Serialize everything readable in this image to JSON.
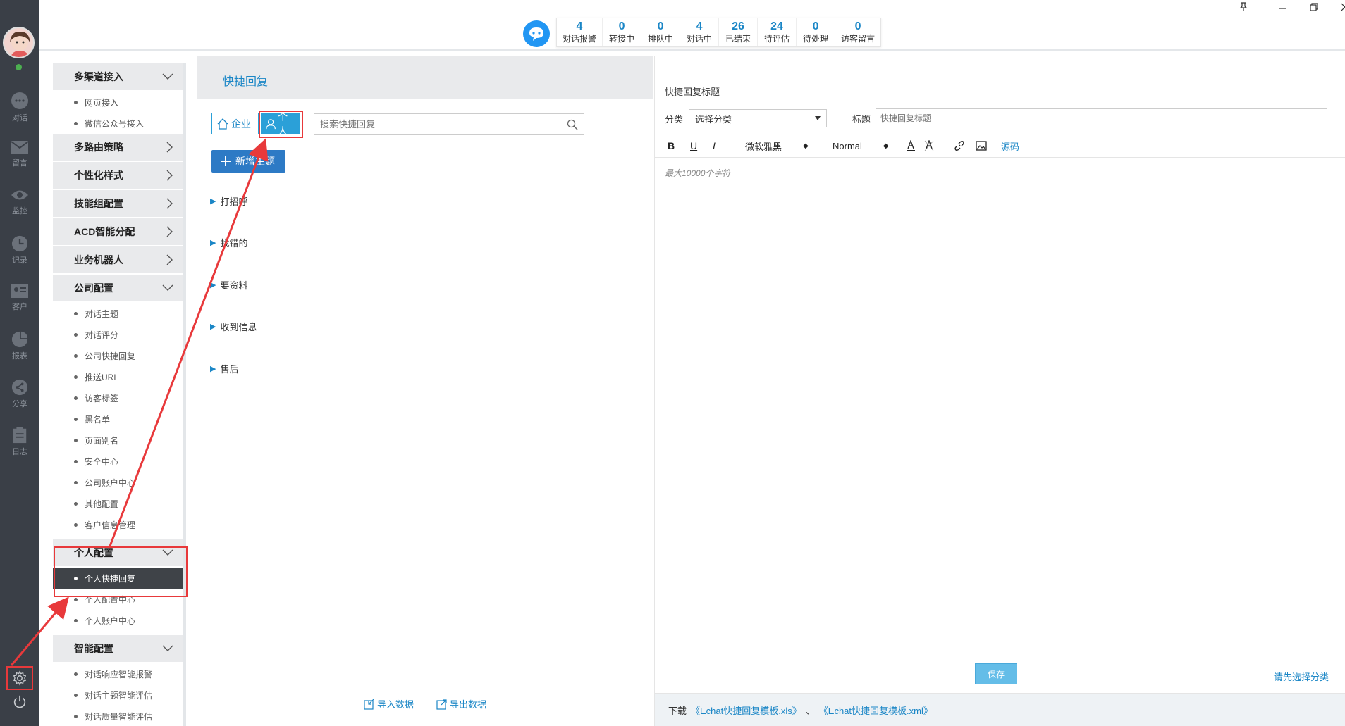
{
  "sidebar": {
    "nav": [
      {
        "label": "对话",
        "icon": "chat-icon"
      },
      {
        "label": "留言",
        "icon": "mail-icon"
      },
      {
        "label": "监控",
        "icon": "eye-icon"
      },
      {
        "label": "记录",
        "icon": "clock-icon"
      },
      {
        "label": "客户",
        "icon": "contact-card-icon"
      },
      {
        "label": "报表",
        "icon": "pie-chart-icon"
      },
      {
        "label": "分享",
        "icon": "share-icon"
      },
      {
        "label": "日志",
        "icon": "clipboard-icon"
      }
    ]
  },
  "stats": [
    {
      "num": "4",
      "label": "对话报警"
    },
    {
      "num": "0",
      "label": "转接中"
    },
    {
      "num": "0",
      "label": "排队中"
    },
    {
      "num": "4",
      "label": "对话中"
    },
    {
      "num": "26",
      "label": "已结束"
    },
    {
      "num": "24",
      "label": "待评估"
    },
    {
      "num": "0",
      "label": "待处理"
    },
    {
      "num": "0",
      "label": "访客留言"
    }
  ],
  "menu": {
    "g1": "多渠道接入",
    "g1_items": [
      "网页接入",
      "微信公众号接入"
    ],
    "g2": "多路由策略",
    "g3": "个性化样式",
    "g4": "技能组配置",
    "g5": "ACD智能分配",
    "g6": "业务机器人",
    "g7": "公司配置",
    "g7_items": [
      "对话主题",
      "对话评分",
      "公司快捷回复",
      "推送URL",
      "访客标签",
      "黑名单",
      "页面别名",
      "安全中心",
      "公司账户中心",
      "其他配置",
      "客户信息管理"
    ],
    "g8": "个人配置",
    "g8_items": [
      "个人快捷回复",
      "个人配置中心",
      "个人账户中心"
    ],
    "g9": "智能配置",
    "g9_items": [
      "对话响应智能报警",
      "对话主题智能评估",
      "对话质量智能评估"
    ]
  },
  "middle": {
    "header": "快捷回复",
    "tab_enterprise": "企业",
    "tab_personal": "个人",
    "search_placeholder": "搜索快捷回复",
    "add_label": "新增主题",
    "topics": [
      "打招呼",
      "找错的",
      "要资料",
      "收到信息",
      "售后"
    ],
    "import": "导入数据",
    "export": "导出数据"
  },
  "editor": {
    "title": "快捷回复标题",
    "category_label": "分类",
    "category_value": "选择分类",
    "title_label": "标题",
    "title_placeholder": "快捷回复标题",
    "font": "微软雅黑",
    "style": "Normal",
    "source": "源码",
    "placeholder": "最大10000个字符",
    "save": "保存",
    "warn": "请先选择分类",
    "download": "下载",
    "link_xls": "《Echat快捷回复模板.xls》",
    "sep": "、",
    "link_xml": "《Echat快捷回复模板.xml》"
  },
  "colors": {
    "accent": "#1a86c6",
    "sidebar": "#3a3f47",
    "annotation": "#e8393b"
  }
}
